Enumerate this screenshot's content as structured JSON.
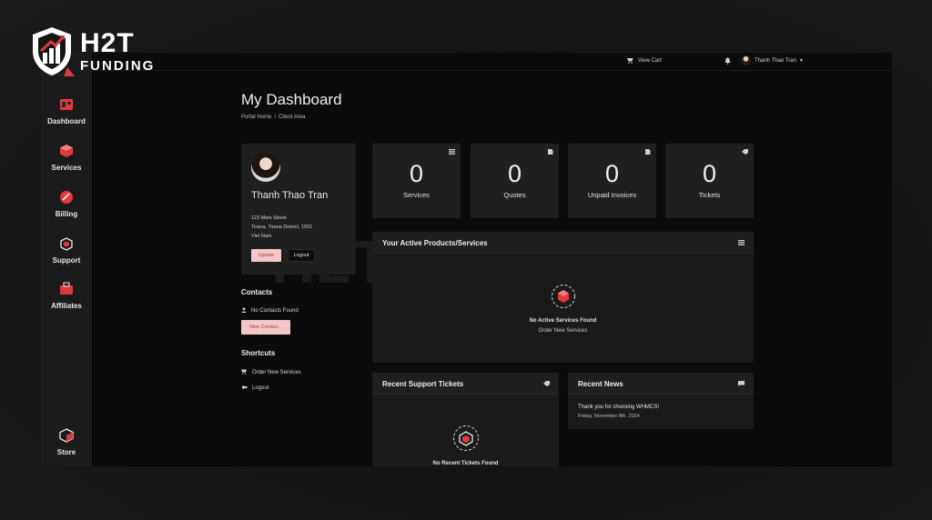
{
  "brand": {
    "line1": "H2T",
    "line2": "FUNDING"
  },
  "watermark": "H2T FUNDING",
  "sidebar": {
    "items": [
      {
        "label": "Dashboard",
        "icon": "dashboard-icon"
      },
      {
        "label": "Services",
        "icon": "services-cube-icon"
      },
      {
        "label": "Billing",
        "icon": "billing-icon"
      },
      {
        "label": "Support",
        "icon": "support-icon"
      },
      {
        "label": "Affiliates",
        "icon": "affiliates-icon"
      },
      {
        "label": "Store",
        "icon": "store-icon"
      }
    ]
  },
  "topbar": {
    "cart_label": "View Cart",
    "user_name": "Thanh Thao Tran"
  },
  "page": {
    "title": "My Dashboard",
    "breadcrumb": [
      "Portal Home",
      "Client Area"
    ]
  },
  "profile": {
    "name": "Thanh Thao Tran",
    "address": [
      "123 Main Street",
      "Tirana, Tirana District, 1001",
      "Viet Nam"
    ],
    "update_label": "Update",
    "logout_label": "Logout"
  },
  "contacts": {
    "heading": "Contacts",
    "empty": "No Contacts Found",
    "new_label": "New Contact..."
  },
  "shortcuts": {
    "heading": "Shortcuts",
    "items": [
      "Order New Services",
      "Logout"
    ]
  },
  "stats": [
    {
      "value": "0",
      "label": "Services"
    },
    {
      "value": "0",
      "label": "Quotes"
    },
    {
      "value": "0",
      "label": "Unpaid Invoices"
    },
    {
      "value": "0",
      "label": "Tickets"
    }
  ],
  "active_products": {
    "title": "Your Active Products/Services",
    "empty": "No Active Services Found",
    "link": "Order New Services"
  },
  "tickets": {
    "title": "Recent Support Tickets",
    "empty": "No Recent Tickets Found"
  },
  "news": {
    "title": "Recent News",
    "item_title": "Thank you for choosing WHMCS!",
    "item_date": "Friday, November 8th, 2024"
  },
  "colors": {
    "accent": "#e0393e",
    "button_pink": "#f5c8c8",
    "panel": "#1f1f1f"
  }
}
